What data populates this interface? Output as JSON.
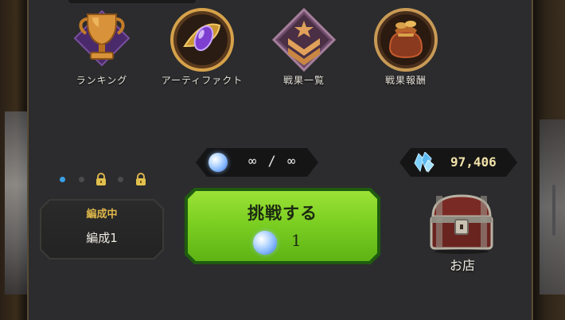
{
  "menu": {
    "items": [
      {
        "label": "ランキング",
        "icon": "trophy-icon"
      },
      {
        "label": "アーティファクト",
        "icon": "gem-amulet-icon"
      },
      {
        "label": "戦果一覧",
        "icon": "rank-chevron-icon"
      },
      {
        "label": "戦果報酬",
        "icon": "treasure-bag-icon"
      }
    ]
  },
  "stamina": {
    "current": "∞",
    "separator": "/",
    "max": "∞",
    "icon": "stamina-orb-icon"
  },
  "gems": {
    "count": "97,406",
    "icon": "crystal-icon"
  },
  "formation": {
    "status": "編成中",
    "name": "編成1",
    "page_dots": 5,
    "active_dot": 1,
    "locked_dots": [
      3,
      5
    ]
  },
  "challenge": {
    "label": "挑戦する",
    "cost": "1",
    "cost_icon": "stamina-orb-icon"
  },
  "shop": {
    "label": "お店",
    "icon": "treasure-chest-icon"
  },
  "colors": {
    "panel": "#2c2c2e",
    "challenge_green": "#7ccf22",
    "accent_blue": "#3aa0e6",
    "formation_status": "#e0b84a"
  }
}
